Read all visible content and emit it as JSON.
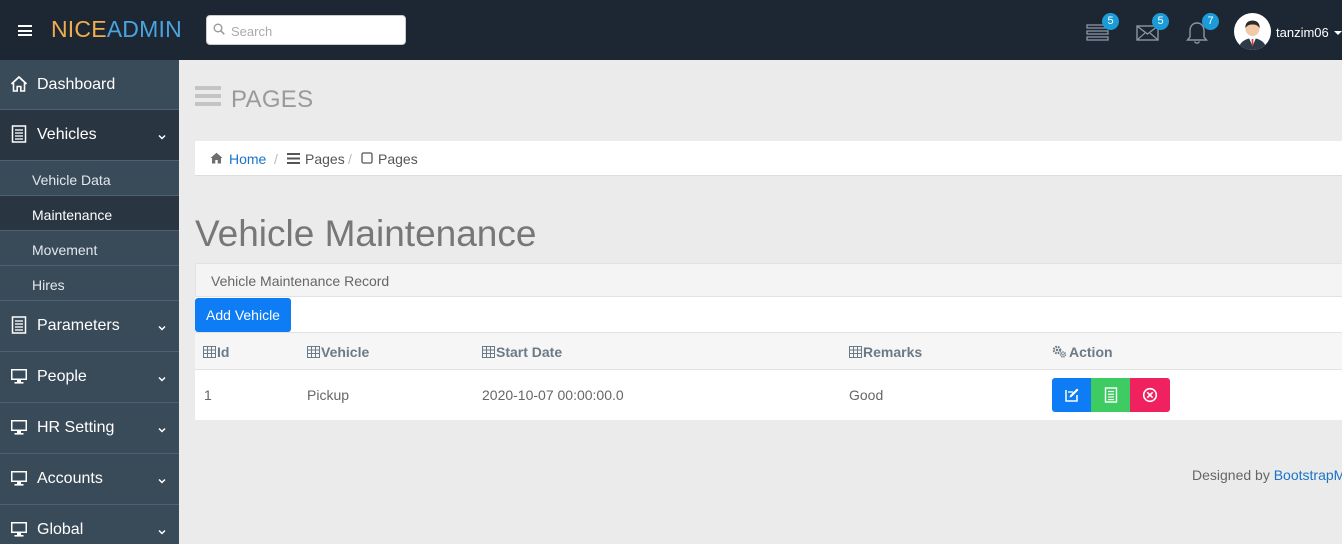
{
  "header": {
    "logo_nice": "NICE",
    "logo_admin": "ADMIN",
    "search_placeholder": "Search",
    "tasks_count": "5",
    "messages_count": "5",
    "notifications_count": "7",
    "username": "tanzim06"
  },
  "sidebar": {
    "items": [
      {
        "label": "Dashboard",
        "icon": "home-icon"
      },
      {
        "label": "Vehicles",
        "icon": "document-icon",
        "expanded": true
      },
      {
        "label": "Parameters",
        "icon": "document-icon"
      },
      {
        "label": "People",
        "icon": "monitor-icon"
      },
      {
        "label": "HR Setting",
        "icon": "monitor-icon"
      },
      {
        "label": "Accounts",
        "icon": "monitor-icon"
      },
      {
        "label": "Global",
        "icon": "monitor-icon"
      }
    ],
    "vehicle_sub": [
      {
        "label": "Vehicle Data"
      },
      {
        "label": "Maintenance",
        "active": true
      },
      {
        "label": "Movement"
      },
      {
        "label": "Hires"
      }
    ]
  },
  "page": {
    "heading": "PAGES",
    "breadcrumb": [
      "Home",
      "Pages",
      "Pages"
    ],
    "title": "Vehicle Maintenance",
    "panel_title": "Vehicle Maintenance Record",
    "add_button": "Add Vehicle"
  },
  "table": {
    "columns": [
      "Id",
      "Vehicle",
      "Start Date",
      "Remarks",
      "Action"
    ],
    "rows": [
      {
        "id": "1",
        "vehicle": "Pickup",
        "start_date": "2020-10-07 00:00:00.0",
        "remarks": "Good"
      }
    ]
  },
  "footer": {
    "prefix": "Designed by ",
    "link": "BootstrapM"
  },
  "colors": {
    "topbar": "#1c2733",
    "sidebar": "#394a59",
    "sidebar_active": "#2a3542",
    "primary": "#0d7cf5",
    "success": "#3ecb62",
    "danger": "#f0215f",
    "badge": "#1b9cd8"
  }
}
